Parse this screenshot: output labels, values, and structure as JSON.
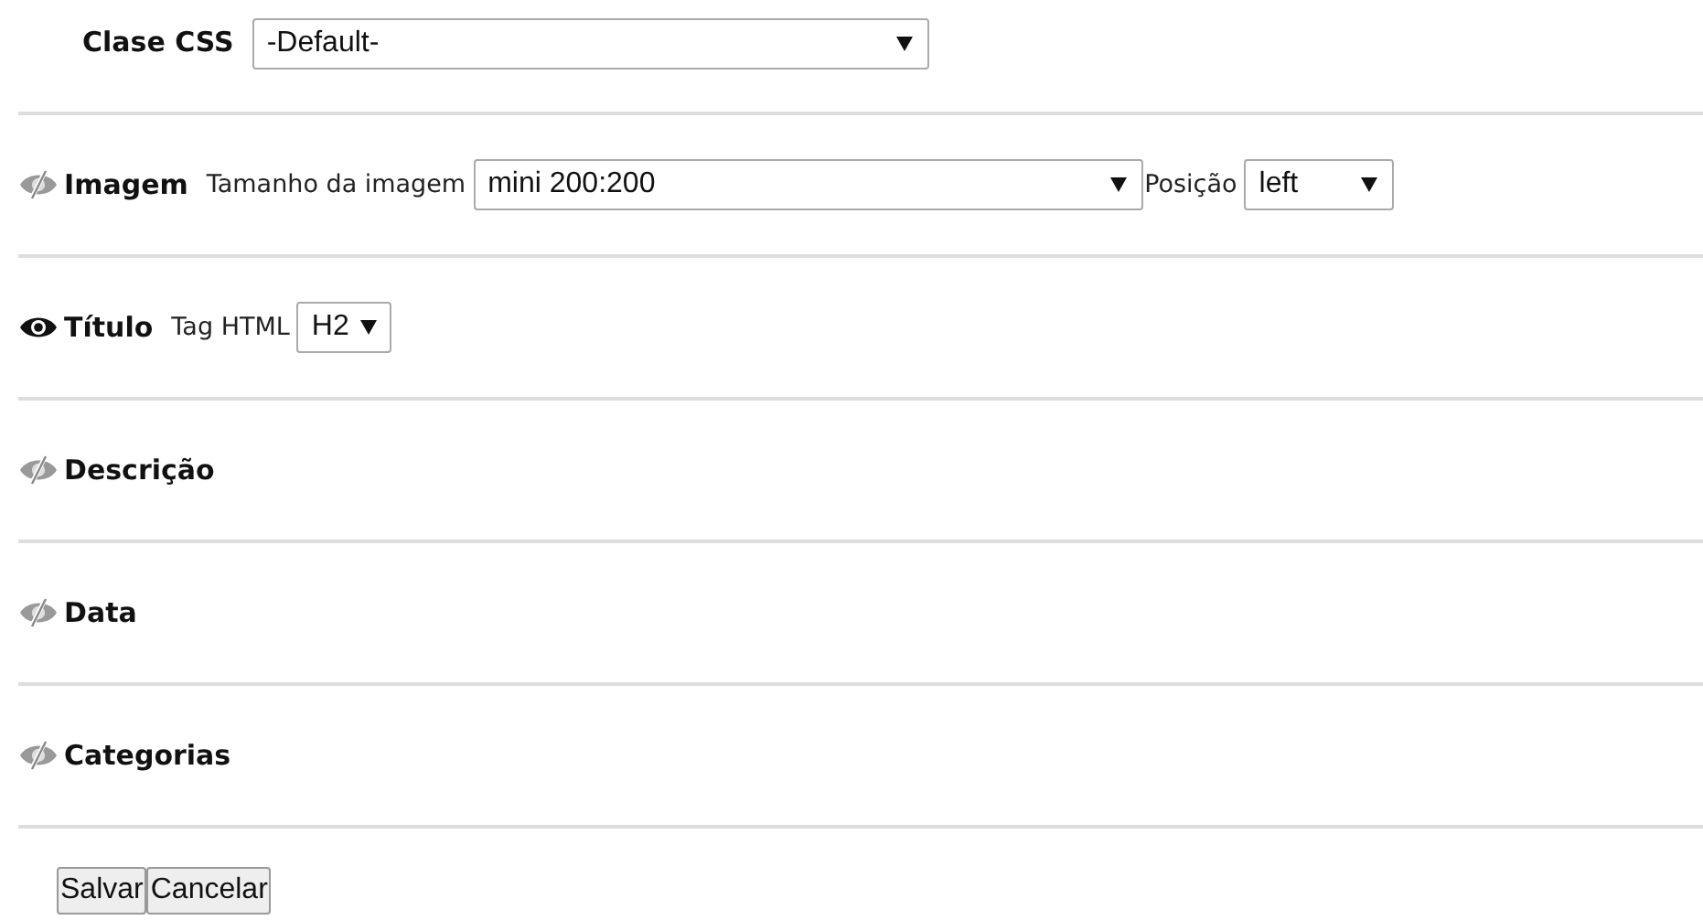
{
  "css_class": {
    "label": "Clase CSS",
    "value": "-Default-"
  },
  "sections": [
    {
      "title": "Imagem",
      "visible": false,
      "fields": [
        {
          "label": "Tamanho da imagem",
          "value": "mini 200:200"
        },
        {
          "label": "Posição",
          "value": "left"
        }
      ]
    },
    {
      "title": "Título",
      "visible": true,
      "fields": [
        {
          "label": "Tag HTML",
          "value": "H2"
        }
      ]
    },
    {
      "title": "Descrição",
      "visible": false
    },
    {
      "title": "Data",
      "visible": false
    },
    {
      "title": "Categorias",
      "visible": false
    }
  ],
  "buttons": [
    "Salvar",
    "Cancelar"
  ]
}
